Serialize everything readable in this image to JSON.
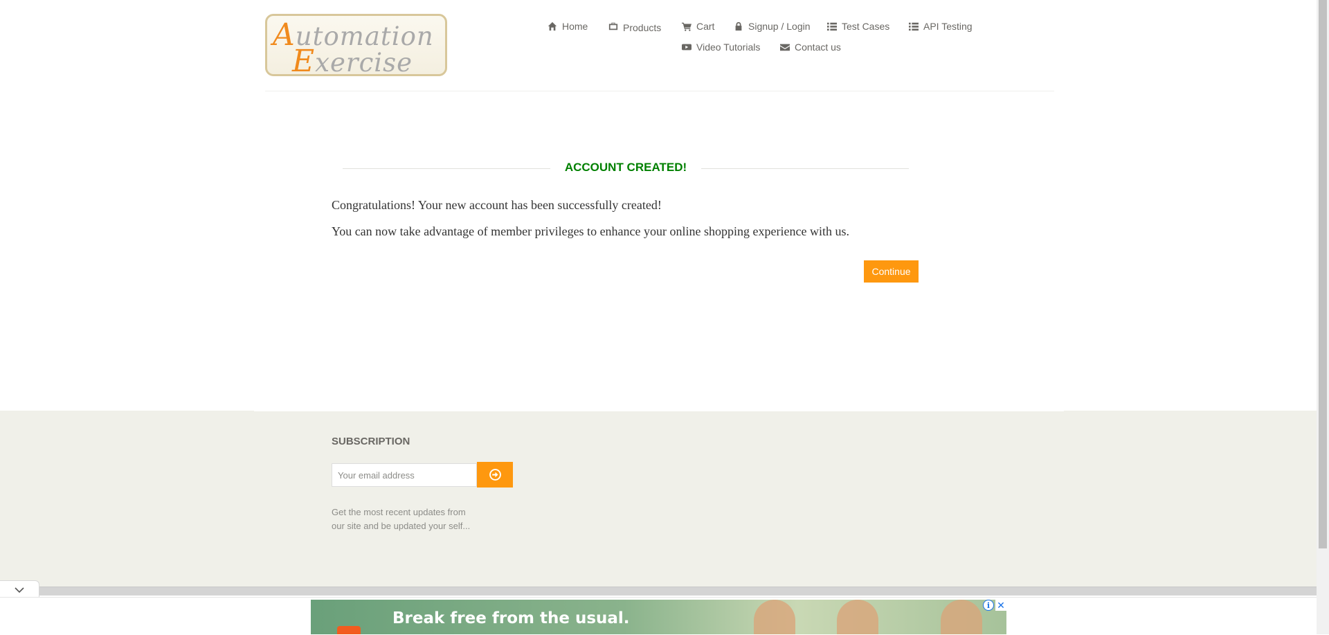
{
  "logo": {
    "line1_first": "A",
    "line1_rest": "utomation",
    "line2_first": "E",
    "line2_rest": "xercise"
  },
  "nav": {
    "home": "Home",
    "products": "Products",
    "cart": "Cart",
    "signup": "Signup / Login",
    "test_cases": "Test Cases",
    "api_testing": "API Testing",
    "video_tutorials": "Video Tutorials",
    "contact_us": "Contact us"
  },
  "main": {
    "title": "ACCOUNT CREATED!",
    "message1": "Congratulations! Your new account has been successfully created!",
    "message2": "You can now take advantage of member privileges to enhance your online shopping experience with us.",
    "continue_label": "Continue"
  },
  "footer": {
    "subscription_title": "SUBSCRIPTION",
    "email_placeholder": "Your email address",
    "description_line1": "Get the most recent updates from",
    "description_line2": "our site and be updated your self..."
  },
  "ad": {
    "headline": "Break free from the usual.",
    "info_icon": "i",
    "close_icon": "✕"
  },
  "colors": {
    "accent": "#fe980f",
    "success": "#008000",
    "footer_bg": "#f0f0e9",
    "text": "#696763"
  },
  "icons": {
    "home": "home-icon",
    "products": "shopping-bag-icon",
    "cart": "cart-icon",
    "signup": "lock-icon",
    "test_cases": "list-icon",
    "api_testing": "list-icon",
    "video": "youtube-icon",
    "contact": "envelope-icon",
    "subscribe": "arrow-circle-right-icon",
    "collapse": "chevron-down-icon"
  }
}
